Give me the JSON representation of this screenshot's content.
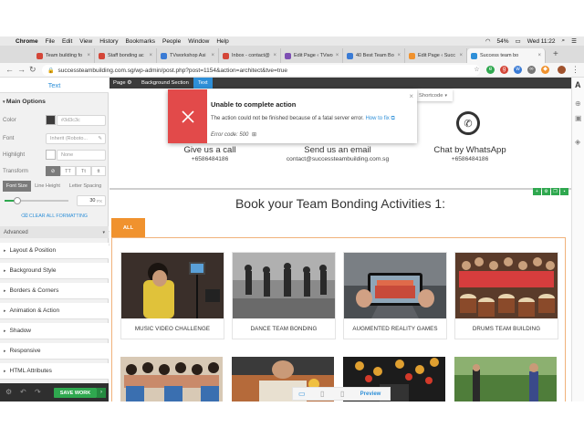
{
  "menubar": {
    "app": "Chrome",
    "items": [
      "File",
      "Edit",
      "View",
      "History",
      "Bookmarks",
      "People",
      "Window",
      "Help"
    ],
    "battery": "54%",
    "clock": "Wed 11:22"
  },
  "tabs": [
    {
      "label": "Team building fo",
      "color": "#d44638"
    },
    {
      "label": "Staff bonding ac",
      "color": "#d44638"
    },
    {
      "label": "TVworkshop Asi",
      "color": "#3a7bd5"
    },
    {
      "label": "Inbox - contact@",
      "color": "#d44638"
    },
    {
      "label": "Edit Page ‹ TVwo",
      "color": "#7d4fb3"
    },
    {
      "label": "40 Best Team Bo",
      "color": "#3a7bd5"
    },
    {
      "label": "Edit Page ‹ Succ",
      "color": "#f0922e"
    },
    {
      "label": "Success team bo",
      "color": "#2e8fd8"
    }
  ],
  "address": {
    "url": "successteambuilding.com.sg/wp-admin/post.php?post=1154&action=architect&tve=true"
  },
  "left_panel": {
    "title": "Text",
    "main_options": "Main Options",
    "color_label": "Color",
    "color_value": "#3d3c3c",
    "font_label": "Font",
    "font_value": "Inherit (Roboto...",
    "highlight_label": "Highlight",
    "highlight_value": "None",
    "transform_label": "Transform",
    "transform_opts": [
      "⊘",
      "TT",
      "Tt",
      "tt"
    ],
    "size_tabs": [
      "Font Size",
      "Line Height",
      "Letter Spacing"
    ],
    "font_size": "30",
    "font_unit": "PX",
    "font_size_fraction": 0.2,
    "clear_formatting": "CLEAR ALL FORMATTING",
    "advanced": "Advanced",
    "sections": [
      "Layout & Position",
      "Background Style",
      "Borders & Corners",
      "Animation & Action",
      "Shadow",
      "Responsive",
      "HTML Attributes"
    ],
    "save_label": "SAVE WORK"
  },
  "breadcrumbs": [
    "Page",
    "Background Section",
    "Text"
  ],
  "contacts": [
    {
      "title": "Give us a call",
      "sub": "+6586484186"
    },
    {
      "title": "Send us an email",
      "sub": "contact@successteambuilding.com.sg"
    },
    {
      "title": "Chat by WhatsApp",
      "sub": "+6586484186"
    }
  ],
  "book_title": "Book your Team Bonding Activities 1:",
  "filter_all": "ALL",
  "cards": [
    {
      "caption": "MUSIC VIDEO CHALLENGE"
    },
    {
      "caption": "DANCE TEAM BONDING"
    },
    {
      "caption": "AUGMENTED REALITY GAMES"
    },
    {
      "caption": "DRUMS TEAM BUILDING"
    }
  ],
  "toast": {
    "title": "Unable to complete action",
    "message": "The action could not be finished because of a fatal server error.",
    "link": "How to fix",
    "code": "Error code: 500"
  },
  "shortcode": "Shortcode",
  "preview": "Preview",
  "colors": {
    "accent": "#2e8fd8",
    "save_green": "#2fa84f",
    "error_red": "#e24a4a",
    "orange": "#f0922e"
  }
}
